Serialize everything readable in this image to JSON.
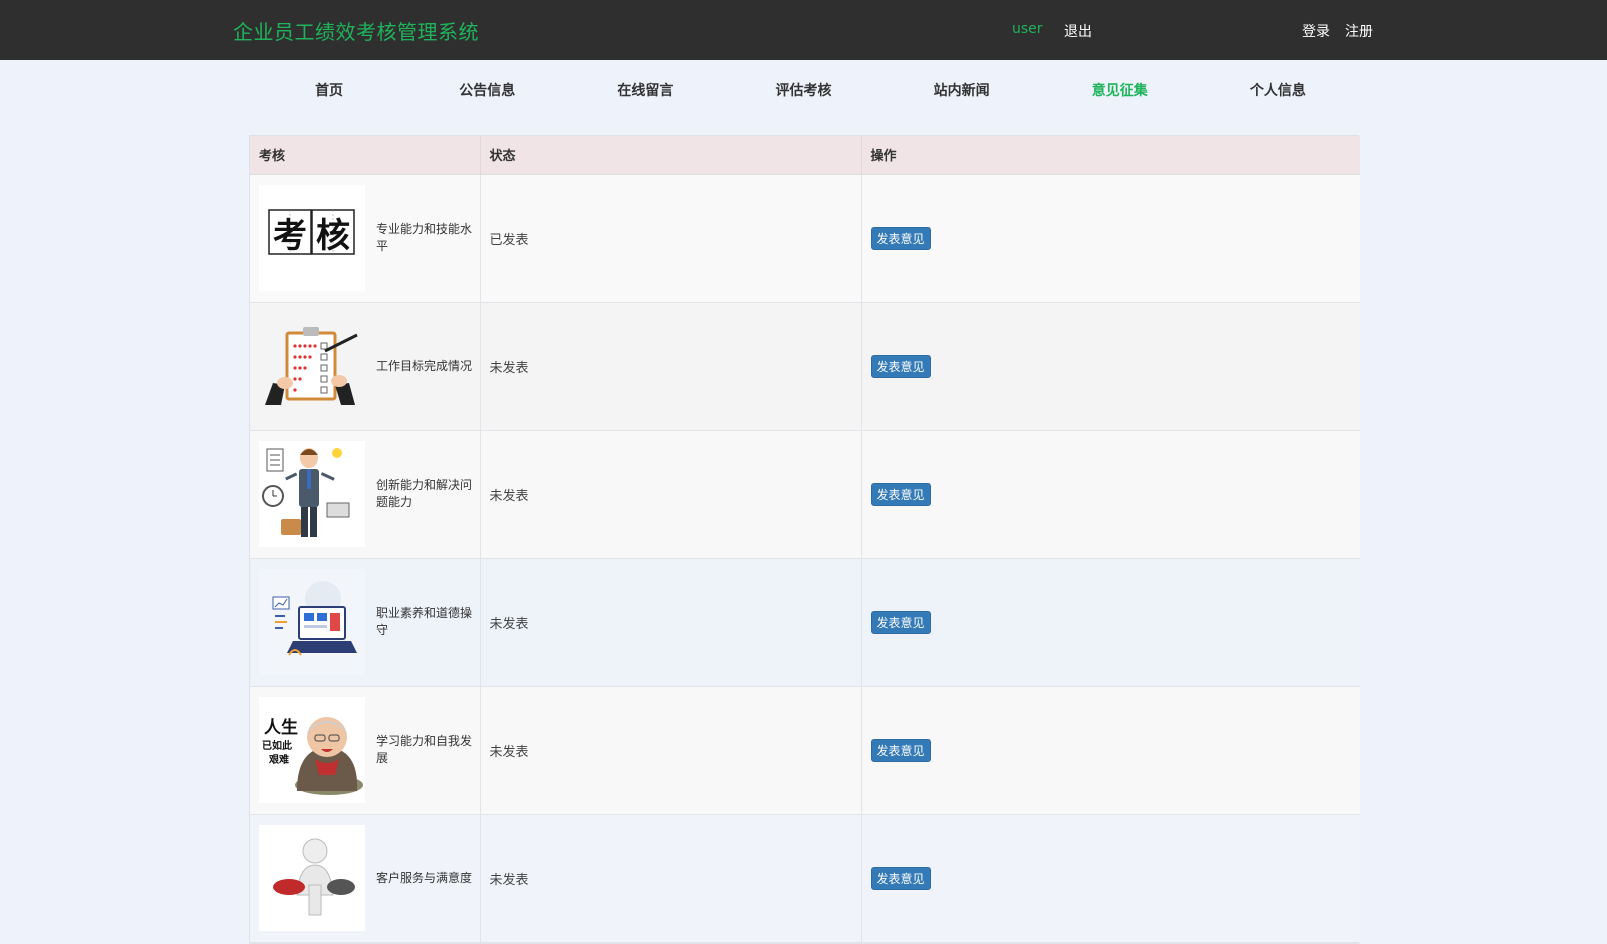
{
  "header": {
    "brand": "企业员工绩效考核管理系统",
    "user": "user",
    "logout": "退出",
    "login": "登录",
    "register": "注册"
  },
  "nav": [
    {
      "label": "首页"
    },
    {
      "label": "公告信息"
    },
    {
      "label": "在线留言"
    },
    {
      "label": "评估考核"
    },
    {
      "label": "站内新闻"
    },
    {
      "label": "意见征集",
      "active": true
    },
    {
      "label": "个人信息"
    }
  ],
  "table": {
    "headers": [
      "考核",
      "状态",
      "操作"
    ],
    "rows": [
      {
        "name": "专业能力和技能水平",
        "status": "已发表",
        "action": "发表意见",
        "thumb_text": [
          "考",
          "核"
        ]
      },
      {
        "name": "工作目标完成情况",
        "status": "未发表",
        "action": "发表意见"
      },
      {
        "name": "创新能力和解决问题能力",
        "status": "未发表",
        "action": "发表意见"
      },
      {
        "name": "职业素养和道德操守",
        "status": "未发表",
        "action": "发表意见"
      },
      {
        "name": "学习能力和自我发展",
        "status": "未发表",
        "action": "发表意见",
        "thumb_text": [
          "人生",
          "已如此",
          "艰难"
        ]
      },
      {
        "name": "客户服务与满意度",
        "status": "未发表",
        "action": "发表意见"
      }
    ]
  },
  "colors": {
    "brand_green": "#1fb35b",
    "header_bg": "#2f2f2f",
    "button_blue": "#337ab7",
    "table_head_bg": "#f0e4e6"
  }
}
